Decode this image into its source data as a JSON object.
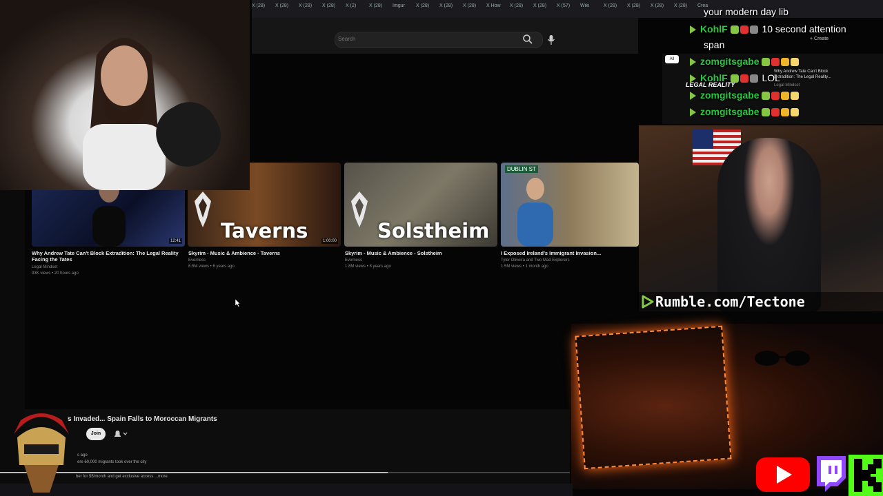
{
  "browser": {
    "tabs": [
      "X (28)",
      "X (28)",
      "X (28)",
      "X (28)",
      "X (2)",
      "X (28)",
      "Imgur",
      "X (28)",
      "X (28)",
      "X (28)",
      "X How",
      "X (28)",
      "X (28)",
      "X (57)",
      "Wiki",
      "X (28)",
      "X (28)",
      "X (28)",
      "X (28)",
      "Crea"
    ],
    "search_placeholder": "Search",
    "create_label": "+ Create",
    "chip_all": "All"
  },
  "videos": [
    {
      "title": "Why Andrew Tate Can't Block Extradition: The Legal Reality Facing the Tates",
      "channel": "Legal Mindset",
      "meta": "93K views • 20 hours ago",
      "duration": "12:41",
      "thumb_text": ""
    },
    {
      "title": "Skyrim - Music & Ambience - Taverns",
      "channel": "Everness",
      "meta": "6.5M views • 6 years ago",
      "duration": "1:00:00",
      "thumb_text": "Taverns"
    },
    {
      "title": "Skyrim - Music & Ambience - Solstheim",
      "channel": "Everness",
      "meta": "1.8M views • 8 years ago",
      "duration": "",
      "thumb_text": "Solstheim"
    },
    {
      "title": "I Exposed Ireland's Immigrant Invasion...",
      "channel": "Tyler Oliveira and Two Mad Explorers",
      "meta": "1.5M views • 1 month ago",
      "duration": "",
      "thumb_text": "DUBLIN ST"
    }
  ],
  "chat": [
    {
      "user": "",
      "message": "your modern day lib"
    },
    {
      "user": "KohlF",
      "message": "10 second attention"
    },
    {
      "user": "",
      "message": "span"
    },
    {
      "user": "zomgitsgabe",
      "message": ""
    },
    {
      "user": "KohlF",
      "message": "LOL"
    },
    {
      "user": "zomgitsgabe",
      "message": ""
    },
    {
      "user": "zomgitsgabe",
      "message": ""
    }
  ],
  "sidebar_preview": {
    "title": "Why Andrew Tate Can't Block Extradition: The Legal Reality...",
    "channel": "Legal Mindset",
    "overlay": "LEGAL REALITY"
  },
  "rumble": {
    "text": "Rumble.com/Tectone"
  },
  "bottom": {
    "title": "s Invaded... Spain Falls to Moroccan Migrants",
    "join_label": "Join",
    "desc_line1": "s ago",
    "desc_line2": "ere 60,000 migrants took over the city",
    "desc_line3": "ber for $5/month and get exclusive access ...more"
  },
  "colors": {
    "chat_username": "#28c840",
    "rumble_green": "#85c742",
    "youtube_red": "#ff0000",
    "twitch_purple": "#9146ff",
    "kick_green": "#53fc18"
  },
  "icons": [
    "search-icon",
    "mic-icon",
    "bell-icon",
    "rumble-icon",
    "youtube-icon",
    "twitch-icon",
    "kick-icon",
    "cursor-icon"
  ],
  "video_progress_fraction": 0.68
}
